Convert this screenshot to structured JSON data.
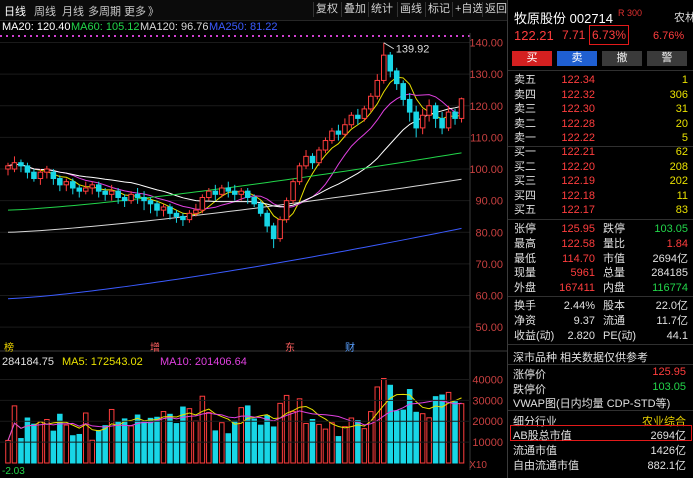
{
  "toolbar": {
    "tabs": [
      "日线",
      "周线",
      "月线",
      "多周期",
      "更多"
    ],
    "tab_suffix": "》",
    "buttons": [
      "复权",
      "叠加",
      "统计",
      "画线",
      "标记",
      "+自选",
      "返回"
    ]
  },
  "ma_legend": [
    {
      "text": "MA20: 120.40",
      "color": "#ffffff"
    },
    {
      "text": "MA60: 105.12",
      "color": "#22d64a"
    },
    {
      "text": "MA120: 96.76",
      "color": "#d8d8d8"
    },
    {
      "text": "MA250: 81.22",
      "color": "#3b5bff"
    }
  ],
  "volume_legend": [
    {
      "text": "284184.75",
      "color": "#e0e0e0"
    },
    {
      "text": "MA5: 172543.02",
      "color": "#e8e000"
    },
    {
      "text": "MA10: 201406.64",
      "color": "#e040e0"
    }
  ],
  "price_axis": [
    "140.00",
    "130.00",
    "120.00",
    "110.00",
    "100.00",
    "90.00",
    "80.00",
    "70.00",
    "60.00",
    "50.00"
  ],
  "volume_axis": [
    "40000",
    "30000",
    "20000",
    "10000",
    "X10"
  ],
  "high_marker": "139.92",
  "bottom_left_value": "-2.03",
  "event_markers": [
    {
      "label": "榜",
      "color": "#e8d000"
    },
    {
      "label": "增",
      "color": "#ff6060"
    },
    {
      "label": "东",
      "color": "#ff6060"
    },
    {
      "label": "财",
      "color": "#5aa0ff"
    }
  ],
  "chart_data": {
    "type": "candlestick",
    "high": 139.92,
    "ylim": [
      45,
      143
    ],
    "series": [
      {
        "name": "MA20",
        "last": 120.4
      },
      {
        "name": "MA60",
        "last": 105.12
      },
      {
        "name": "MA120",
        "last": 96.76
      },
      {
        "name": "MA250",
        "last": 81.22
      }
    ],
    "volume_series": [
      {
        "name": "VOL",
        "last": 284184.75
      },
      {
        "name": "MA5",
        "last": 172543.02
      },
      {
        "name": "MA10",
        "last": 201406.64
      }
    ],
    "candles": [
      {
        "o": 100,
        "c": 101,
        "h": 102,
        "l": 98
      },
      {
        "o": 100,
        "c": 102,
        "h": 104,
        "l": 99
      },
      {
        "o": 102,
        "c": 101,
        "h": 103,
        "l": 99
      },
      {
        "o": 101,
        "c": 99,
        "h": 102,
        "l": 97
      },
      {
        "o": 99,
        "c": 97,
        "h": 100,
        "l": 96
      },
      {
        "o": 97,
        "c": 99,
        "h": 100,
        "l": 95
      },
      {
        "o": 99,
        "c": 100,
        "h": 101,
        "l": 97
      },
      {
        "o": 99,
        "c": 97,
        "h": 100,
        "l": 95
      },
      {
        "o": 97,
        "c": 95,
        "h": 98,
        "l": 93
      },
      {
        "o": 95,
        "c": 96,
        "h": 97,
        "l": 93
      },
      {
        "o": 96,
        "c": 94,
        "h": 97,
        "l": 92
      },
      {
        "o": 94,
        "c": 93,
        "h": 95,
        "l": 91
      },
      {
        "o": 93,
        "c": 94,
        "h": 96,
        "l": 92
      },
      {
        "o": 94,
        "c": 95,
        "h": 96,
        "l": 92
      },
      {
        "o": 95,
        "c": 93,
        "h": 96,
        "l": 91
      },
      {
        "o": 93,
        "c": 92,
        "h": 94,
        "l": 90
      },
      {
        "o": 92,
        "c": 93,
        "h": 95,
        "l": 90
      },
      {
        "o": 93,
        "c": 91,
        "h": 94,
        "l": 89
      },
      {
        "o": 91,
        "c": 90,
        "h": 92,
        "l": 88
      },
      {
        "o": 90,
        "c": 92,
        "h": 93,
        "l": 89
      },
      {
        "o": 92,
        "c": 91,
        "h": 94,
        "l": 89
      },
      {
        "o": 91,
        "c": 90,
        "h": 93,
        "l": 87
      },
      {
        "o": 90,
        "c": 89,
        "h": 91,
        "l": 86
      },
      {
        "o": 89,
        "c": 87,
        "h": 90,
        "l": 85
      },
      {
        "o": 87,
        "c": 88,
        "h": 89,
        "l": 85
      },
      {
        "o": 88,
        "c": 86,
        "h": 89,
        "l": 84
      },
      {
        "o": 86,
        "c": 85,
        "h": 87,
        "l": 83
      },
      {
        "o": 85,
        "c": 84,
        "h": 86,
        "l": 82
      },
      {
        "o": 84,
        "c": 86,
        "h": 87,
        "l": 83
      },
      {
        "o": 86,
        "c": 87,
        "h": 89,
        "l": 85
      },
      {
        "o": 87,
        "c": 91,
        "h": 92,
        "l": 86
      },
      {
        "o": 91,
        "c": 93,
        "h": 94,
        "l": 90
      },
      {
        "o": 93,
        "c": 92,
        "h": 95,
        "l": 90
      },
      {
        "o": 92,
        "c": 94,
        "h": 95,
        "l": 91
      },
      {
        "o": 94,
        "c": 93,
        "h": 96,
        "l": 91
      },
      {
        "o": 93,
        "c": 92,
        "h": 95,
        "l": 90
      },
      {
        "o": 92,
        "c": 93,
        "h": 94,
        "l": 90
      },
      {
        "o": 93,
        "c": 91,
        "h": 94,
        "l": 89
      },
      {
        "o": 91,
        "c": 89,
        "h": 92,
        "l": 88
      },
      {
        "o": 89,
        "c": 86,
        "h": 90,
        "l": 85
      },
      {
        "o": 86,
        "c": 82,
        "h": 87,
        "l": 80
      },
      {
        "o": 82,
        "c": 78,
        "h": 83,
        "l": 75
      },
      {
        "o": 78,
        "c": 84,
        "h": 85,
        "l": 77
      },
      {
        "o": 84,
        "c": 90,
        "h": 91,
        "l": 83
      },
      {
        "o": 90,
        "c": 96,
        "h": 97,
        "l": 89
      },
      {
        "o": 96,
        "c": 101,
        "h": 102,
        "l": 95
      },
      {
        "o": 101,
        "c": 104,
        "h": 106,
        "l": 100
      },
      {
        "o": 104,
        "c": 102,
        "h": 105,
        "l": 100
      },
      {
        "o": 102,
        "c": 106,
        "h": 107,
        "l": 101
      },
      {
        "o": 106,
        "c": 109,
        "h": 110,
        "l": 105
      },
      {
        "o": 109,
        "c": 112,
        "h": 113,
        "l": 108
      },
      {
        "o": 112,
        "c": 111,
        "h": 114,
        "l": 109
      },
      {
        "o": 111,
        "c": 114,
        "h": 116,
        "l": 110
      },
      {
        "o": 114,
        "c": 117,
        "h": 118,
        "l": 113
      },
      {
        "o": 117,
        "c": 116,
        "h": 119,
        "l": 114
      },
      {
        "o": 116,
        "c": 119,
        "h": 120,
        "l": 115
      },
      {
        "o": 119,
        "c": 123,
        "h": 124,
        "l": 118
      },
      {
        "o": 123,
        "c": 128,
        "h": 130,
        "l": 122
      },
      {
        "o": 128,
        "c": 136,
        "h": 139.92,
        "l": 127
      },
      {
        "o": 136,
        "c": 131,
        "h": 137,
        "l": 129
      },
      {
        "o": 131,
        "c": 127,
        "h": 132,
        "l": 125
      },
      {
        "o": 127,
        "c": 122,
        "h": 128,
        "l": 120
      },
      {
        "o": 122,
        "c": 118,
        "h": 124,
        "l": 115
      },
      {
        "o": 118,
        "c": 113,
        "h": 120,
        "l": 110
      },
      {
        "o": 113,
        "c": 117,
        "h": 119,
        "l": 111
      },
      {
        "o": 117,
        "c": 120,
        "h": 122,
        "l": 115
      },
      {
        "o": 120,
        "c": 116,
        "h": 121,
        "l": 113
      },
      {
        "o": 116,
        "c": 113,
        "h": 118,
        "l": 111
      },
      {
        "o": 113,
        "c": 118,
        "h": 120,
        "l": 112
      },
      {
        "o": 118,
        "c": 116,
        "h": 119,
        "l": 114
      },
      {
        "o": 116,
        "c": 122.21,
        "h": 122.58,
        "l": 114.7
      }
    ]
  },
  "panel": {
    "name": "牧原股份",
    "code": "002714",
    "r_tag": "R 300",
    "sector": "农林牧渔",
    "price": "122.21",
    "change": "7.71",
    "pct": "6.73%",
    "sector_pct": "6.76%",
    "actions": [
      "买",
      "卖",
      "撤",
      "警"
    ],
    "asks": [
      {
        "label": "卖五",
        "price": "122.34",
        "vol": "1"
      },
      {
        "label": "卖四",
        "price": "122.32",
        "vol": "306"
      },
      {
        "label": "卖三",
        "price": "122.30",
        "vol": "31"
      },
      {
        "label": "卖二",
        "price": "122.28",
        "vol": "20"
      },
      {
        "label": "卖一",
        "price": "122.22",
        "vol": "5"
      }
    ],
    "bids": [
      {
        "label": "买一",
        "price": "122.21",
        "vol": "62"
      },
      {
        "label": "买二",
        "price": "122.20",
        "vol": "208"
      },
      {
        "label": "买三",
        "price": "122.19",
        "vol": "202"
      },
      {
        "label": "买四",
        "price": "122.18",
        "vol": "11"
      },
      {
        "label": "买五",
        "price": "122.17",
        "vol": "83"
      }
    ],
    "stats1": [
      [
        "张停",
        "125.95",
        "跌停",
        "103.05"
      ],
      [
        "最高",
        "122.58",
        "量比",
        "1.84"
      ],
      [
        "最低",
        "114.70",
        "市值",
        "2694亿"
      ],
      [
        "现量",
        "5961",
        "总量",
        "284185"
      ],
      [
        "外盘",
        "167411",
        "内盘",
        "116774"
      ]
    ],
    "stats2": [
      [
        "换手",
        "2.44%",
        "股本",
        "22.0亿"
      ],
      [
        "净资",
        "9.37",
        "流通",
        "11.7亿"
      ],
      [
        "收益(动)",
        "2.820",
        "PE(动)",
        "44.1"
      ]
    ],
    "section_title": "深市品种  相关数据仅供参考",
    "limit_up_label": "涨停价",
    "limit_up": "125.95",
    "limit_down_label": "跌停价",
    "limit_down": "103.05",
    "vwap_label": "VWAP图(日内均量 CDP-STD等)",
    "industry_label": "细分行业",
    "industry": "农业综合",
    "ab_label": "AB股总市值",
    "ab_value": "2694亿",
    "float_label": "流通市值",
    "float_value": "1426亿",
    "free_label": "自由流通市值",
    "free_value": "882.1亿"
  }
}
